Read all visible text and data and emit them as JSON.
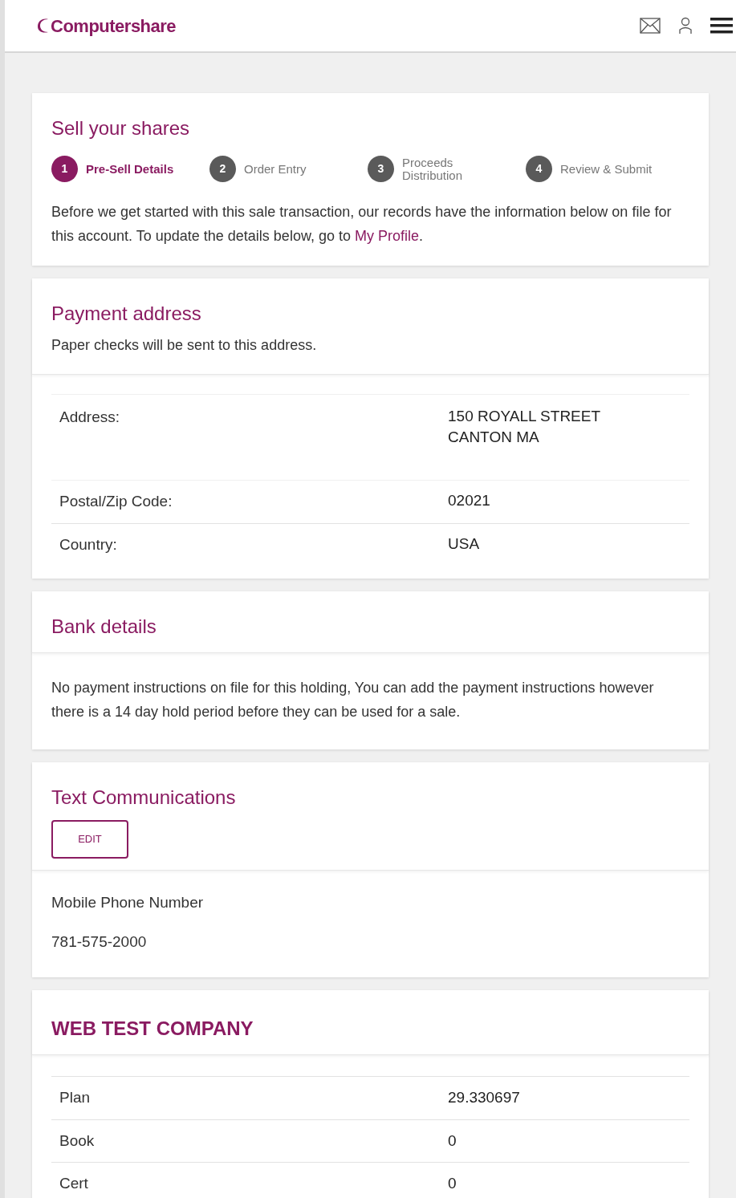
{
  "header": {
    "logo": "Computershare"
  },
  "sell": {
    "title": "Sell your shares",
    "steps": [
      {
        "number": "1",
        "label": "Pre-Sell Details",
        "selected": true
      },
      {
        "number": "2",
        "label": "Order Entry",
        "selected": false
      },
      {
        "number": "3",
        "label": "Proceeds Distribution",
        "selected": false
      },
      {
        "number": "4",
        "label": "Review & Submit",
        "selected": false
      }
    ],
    "intro": "Before we get started with this sale transaction, our records have the information below on file for this account. To update the details below, go to",
    "link": "My Profile",
    "after_link": "."
  },
  "payment_address": {
    "title": "Payment address",
    "subtitle": "Paper checks will be sent to this address.",
    "rows": [
      {
        "label": "Address:",
        "value_lines": [
          "150 ROYALL STREET",
          "CANTON MA"
        ]
      },
      {
        "label": "Postal/Zip Code:",
        "value_lines": [
          "02021"
        ]
      },
      {
        "label": "Country:",
        "value_lines": [
          "USA"
        ]
      }
    ]
  },
  "bank_details": {
    "title": "Bank details",
    "message": "No payment instructions on file for this holding, You can add the payment instructions however there is a 14 day hold period before they can be used for a sale."
  },
  "text_communications": {
    "title": "Text Communications",
    "edit_button": "EDIT",
    "field_label": "Mobile Phone Number",
    "field_value": "781-575-2000"
  },
  "company": {
    "title": "WEB TEST COMPANY",
    "rows": [
      {
        "label": "Plan",
        "value": "29.330697"
      },
      {
        "label": "Book",
        "value": "0"
      },
      {
        "label": "Cert",
        "value": "0"
      }
    ]
  }
}
